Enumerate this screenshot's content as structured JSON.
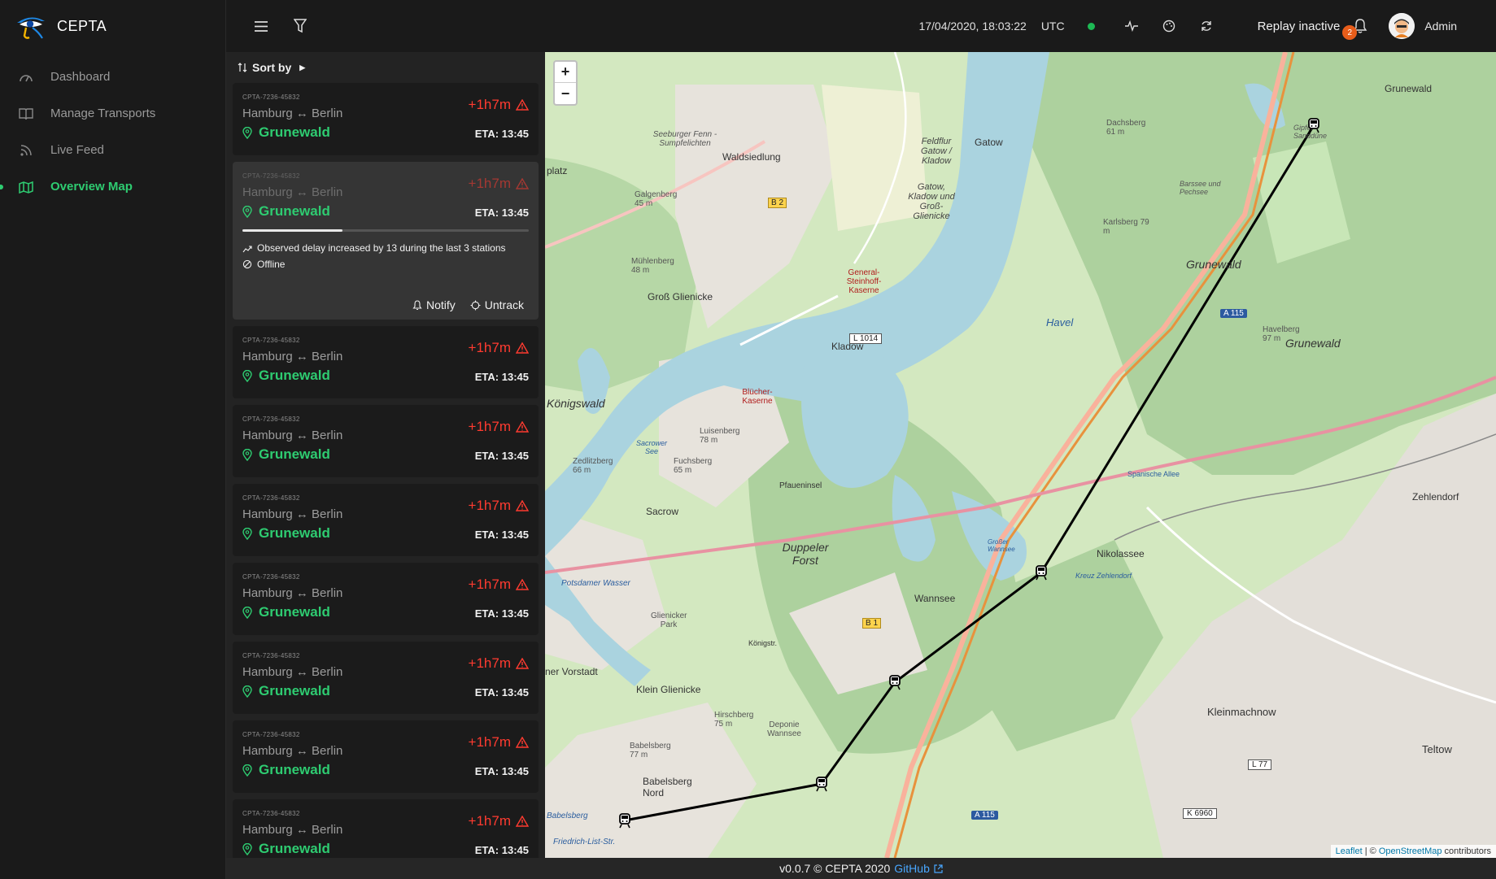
{
  "brand": {
    "name": "CEPTA"
  },
  "nav": [
    {
      "label": "Dashboard",
      "icon": "dashboard-icon"
    },
    {
      "label": "Manage Transports",
      "icon": "book-icon"
    },
    {
      "label": "Live Feed",
      "icon": "rss-icon"
    },
    {
      "label": "Overview Map",
      "icon": "map-icon",
      "active": true
    }
  ],
  "topbar": {
    "datetime": "17/04/2020, 18:03:22",
    "timezone": "UTC",
    "status_color": "#1db954",
    "replay_label": "Replay inactive",
    "notification_count": "2",
    "user_name": "Admin"
  },
  "panel": {
    "sort_label": "Sort by",
    "cards": [
      {
        "id": "CPTA-7236-45832",
        "route": "Hamburg ↔ Berlin",
        "stop": "Grunewald",
        "delay": "+1h7m",
        "eta": "ETA: 13:45"
      },
      {
        "id": "CPTA-7236-45832",
        "route": "Hamburg ↔ Berlin",
        "stop": "Grunewald",
        "delay": "+1h7m",
        "eta": "ETA: 13:45",
        "expanded": true,
        "progress": 0.35,
        "detail_delay": "Observed delay increased by 13 during the last 3 stations",
        "detail_status": "Offline",
        "notify_label": "Notify",
        "untrack_label": "Untrack"
      },
      {
        "id": "CPTA-7236-45832",
        "route": "Hamburg ↔ Berlin",
        "stop": "Grunewald",
        "delay": "+1h7m",
        "eta": "ETA: 13:45"
      },
      {
        "id": "CPTA-7236-45832",
        "route": "Hamburg ↔ Berlin",
        "stop": "Grunewald",
        "delay": "+1h7m",
        "eta": "ETA: 13:45"
      },
      {
        "id": "CPTA-7236-45832",
        "route": "Hamburg ↔ Berlin",
        "stop": "Grunewald",
        "delay": "+1h7m",
        "eta": "ETA: 13:45"
      },
      {
        "id": "CPTA-7236-45832",
        "route": "Hamburg ↔ Berlin",
        "stop": "Grunewald",
        "delay": "+1h7m",
        "eta": "ETA: 13:45"
      },
      {
        "id": "CPTA-7236-45832",
        "route": "Hamburg ↔ Berlin",
        "stop": "Grunewald",
        "delay": "+1h7m",
        "eta": "ETA: 13:45"
      },
      {
        "id": "CPTA-7236-45832",
        "route": "Hamburg ↔ Berlin",
        "stop": "Grunewald",
        "delay": "+1h7m",
        "eta": "ETA: 13:45"
      },
      {
        "id": "CPTA-7236-45832",
        "route": "Hamburg ↔ Berlin",
        "stop": "Grunewald",
        "delay": "+1h7m",
        "eta": "ETA: 13:45"
      }
    ]
  },
  "map": {
    "zoom_in": "+",
    "zoom_out": "−",
    "place_labels": [
      "Gatow",
      "Waldsiedlung",
      "Seeburger Fenn - Sumpfelichten",
      "Galgenberg 45 m",
      "B 2",
      "Feldflur Gatow / Kladow",
      "Gatow, Kladow und Groß-Glienicke",
      "Dachsberg 61 m",
      "Gipfel Sanddüne",
      "Grunewald",
      "Barssee und Pechsee",
      "Karlsberg 79 m",
      "platz",
      "Mühlenberg 48 m",
      "General-Steinhoff-Kaserne",
      "Groß Glienicke",
      "Kladow",
      "Havel",
      "Havelberg 97 m",
      "A 115",
      "L 1014",
      "Königswald",
      "Blücher-Kaserne",
      "Luisenberg 78 m",
      "Sacrower See",
      "Zedlitzberg 66 m",
      "Fuchsberg 65 m",
      "Pfaueninsel",
      "Spanische Allee",
      "Zehlendorf",
      "Sacrow",
      "Duppeler Forst",
      "Nikolassee",
      "Kreuz Zehlendorf",
      "Wannsee",
      "Großer Wannsee",
      "B 1",
      "Potsdamer Wasser",
      "Glienicker Park",
      "Königstr.",
      "ner Vorstadt",
      "Klein Glienicke",
      "Hirschberg 75 m",
      "Deponie Wannsee",
      "Kleinmachnow",
      "Teltow",
      "Babelsberg 77 m",
      "Babelsberg Nord",
      "A 115",
      "K 6960",
      "L 77",
      "Friedrich-List-Str.",
      "Babelsberg"
    ],
    "attribution_leaflet": "Leaflet",
    "attribution_rest": "| © ",
    "attribution_osm": "OpenStreetMap",
    "attribution_tail": " contributors"
  },
  "footer": {
    "version": "v0.0.7 © CEPTA 2020",
    "github": "GitHub"
  },
  "colors": {
    "accent": "#2ecc71",
    "delay": "#ff3b30",
    "badge": "#e85d1a",
    "link": "#49a7ff"
  }
}
